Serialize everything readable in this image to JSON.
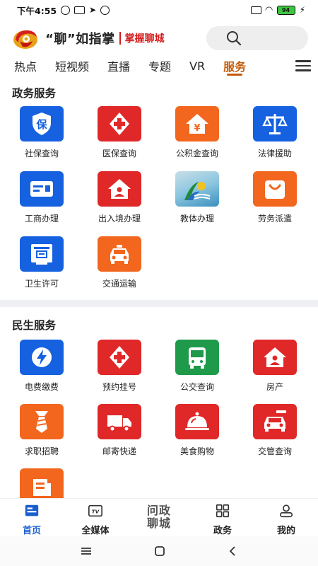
{
  "status_bar": {
    "time": "下午4:55",
    "battery": "94"
  },
  "header": {
    "brand": "“聊”如指掌",
    "slogan": "掌握聊城",
    "search_icon": "search-icon"
  },
  "tabs": [
    {
      "label": "热点",
      "active": false
    },
    {
      "label": "短视频",
      "active": false
    },
    {
      "label": "直播",
      "active": false
    },
    {
      "label": "专题",
      "active": false
    },
    {
      "label": "VR",
      "active": false
    },
    {
      "label": "服务",
      "active": true
    }
  ],
  "gov": {
    "title": "政务服务",
    "items": [
      {
        "label": "社保查询",
        "icon": "shield-icon",
        "color": "#1561e0"
      },
      {
        "label": "医保查询",
        "icon": "medical-cross-icon",
        "color": "#e02828"
      },
      {
        "label": "公积金查询",
        "icon": "house-yuan-icon",
        "color": "#f2661e"
      },
      {
        "label": "法律援助",
        "icon": "scales-icon",
        "color": "#1561e0"
      },
      {
        "label": "工商办理",
        "icon": "id-card-icon",
        "color": "#1561e0"
      },
      {
        "label": "出入境办理",
        "icon": "house-person-icon",
        "color": "#e02828"
      },
      {
        "label": "教体办理",
        "icon": "education-logo-icon",
        "color": "#6fb6d9"
      },
      {
        "label": "劳务派遣",
        "icon": "shopping-bag-icon",
        "color": "#f2661e"
      },
      {
        "label": "卫生许可",
        "icon": "certificate-icon",
        "color": "#1561e0"
      },
      {
        "label": "交通运输",
        "icon": "taxi-icon",
        "color": "#f2661e"
      }
    ]
  },
  "life": {
    "title": "民生服务",
    "items": [
      {
        "label": "电费缴费",
        "icon": "lightning-icon",
        "color": "#1561e0"
      },
      {
        "label": "预约挂号",
        "icon": "medical-cross-icon",
        "color": "#e02828"
      },
      {
        "label": "公交查询",
        "icon": "bus-icon",
        "color": "#1f9a4a"
      },
      {
        "label": "房产",
        "icon": "house-person-icon",
        "color": "#e02828"
      },
      {
        "label": "求职招聘",
        "icon": "tie-icon",
        "color": "#f2661e"
      },
      {
        "label": "邮寄快递",
        "icon": "truck-icon",
        "color": "#e02828"
      },
      {
        "label": "美食购物",
        "icon": "food-cloche-icon",
        "color": "#e02828"
      },
      {
        "label": "交管查询",
        "icon": "car-icon",
        "color": "#e02828"
      },
      {
        "label": "",
        "icon": "document-icon",
        "color": "#f2661e"
      }
    ]
  },
  "bottom_nav": [
    {
      "label": "首页",
      "icon": "home-news-icon",
      "active": true
    },
    {
      "label": "全媒体",
      "icon": "tv-icon",
      "active": false
    },
    {
      "label": "问政聊城",
      "icon": "wenzheng-logo",
      "active": false
    },
    {
      "label": "政务",
      "icon": "grid-icon",
      "active": false
    },
    {
      "label": "我的",
      "icon": "user-icon",
      "active": false
    }
  ],
  "wenzheng": {
    "line1": "问政",
    "line2": "聊城"
  }
}
